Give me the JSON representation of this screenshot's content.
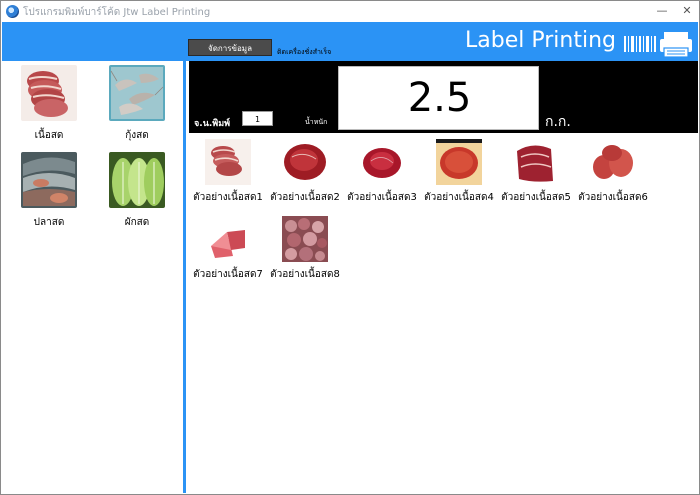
{
  "window": {
    "title": "โปรแกรมพิมพ์บาร์โค้ด Jtw Label Printing",
    "minimize_glyph": "—",
    "close_glyph": "✕"
  },
  "toolbar": {
    "manage_button": "จัดการข้อมูล",
    "connection_status": "ติดเครื่องชั่งสำเร็จ",
    "brand": "Label Printing",
    "brand_icon": "barcode-printer-icon"
  },
  "categories": [
    {
      "label": "เนื้อสด",
      "icon": "fresh-meat-image"
    },
    {
      "label": "กุ้งสด",
      "icon": "fresh-shrimp-image"
    },
    {
      "label": "ปลาสด",
      "icon": "fresh-fish-image"
    },
    {
      "label": "ผักสด",
      "icon": "fresh-vegetable-image"
    }
  ],
  "weighing": {
    "print_qty_label": "จ.น.พิมพ์",
    "print_qty_value": "1",
    "weight_label": "น้ำหนัก",
    "weight_value": "2.5",
    "unit": "ก.ก."
  },
  "products": [
    {
      "label": "ตัวอย่างเนื้อสด1"
    },
    {
      "label": "ตัวอย่างเนื้อสด2"
    },
    {
      "label": "ตัวอย่างเนื้อสด3"
    },
    {
      "label": "ตัวอย่างเนื้อสด4"
    },
    {
      "label": "ตัวอย่างเนื้อสด5"
    },
    {
      "label": "ตัวอย่างเนื้อสด6"
    },
    {
      "label": "ตัวอย่างเนื้อสด7"
    },
    {
      "label": "ตัวอย่างเนื้อสด8"
    }
  ],
  "colors": {
    "accent": "#2b93f5",
    "panel": "#000000"
  }
}
